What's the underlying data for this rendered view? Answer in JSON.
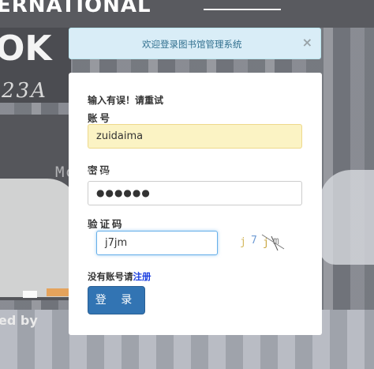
{
  "background": {
    "line1": "ERNATIONAL",
    "line2": "OK",
    "line3": "23A",
    "line4": "ed by"
  },
  "alert": {
    "message": "欢迎登录图书馆管理系统",
    "close_label": "×"
  },
  "form": {
    "error_message": "输入有误！请重试",
    "username_label": "账号",
    "username_value": "zuidaima",
    "password_label": "密码",
    "password_value": "●●●●●●",
    "captcha_label": "验证码",
    "captcha_value": "j7jm",
    "captcha_image_text": "j7jm",
    "register_prompt": "没有账号请",
    "register_link": "注册",
    "submit_label": "登 录"
  },
  "watermark": "Mcdreamy@zuidaima.com",
  "colors": {
    "alert_bg": "#d9edf7",
    "alert_text": "#31708f",
    "button": "#3274b3",
    "autofill": "#fbf3c4",
    "link": "#1a3ee0"
  }
}
